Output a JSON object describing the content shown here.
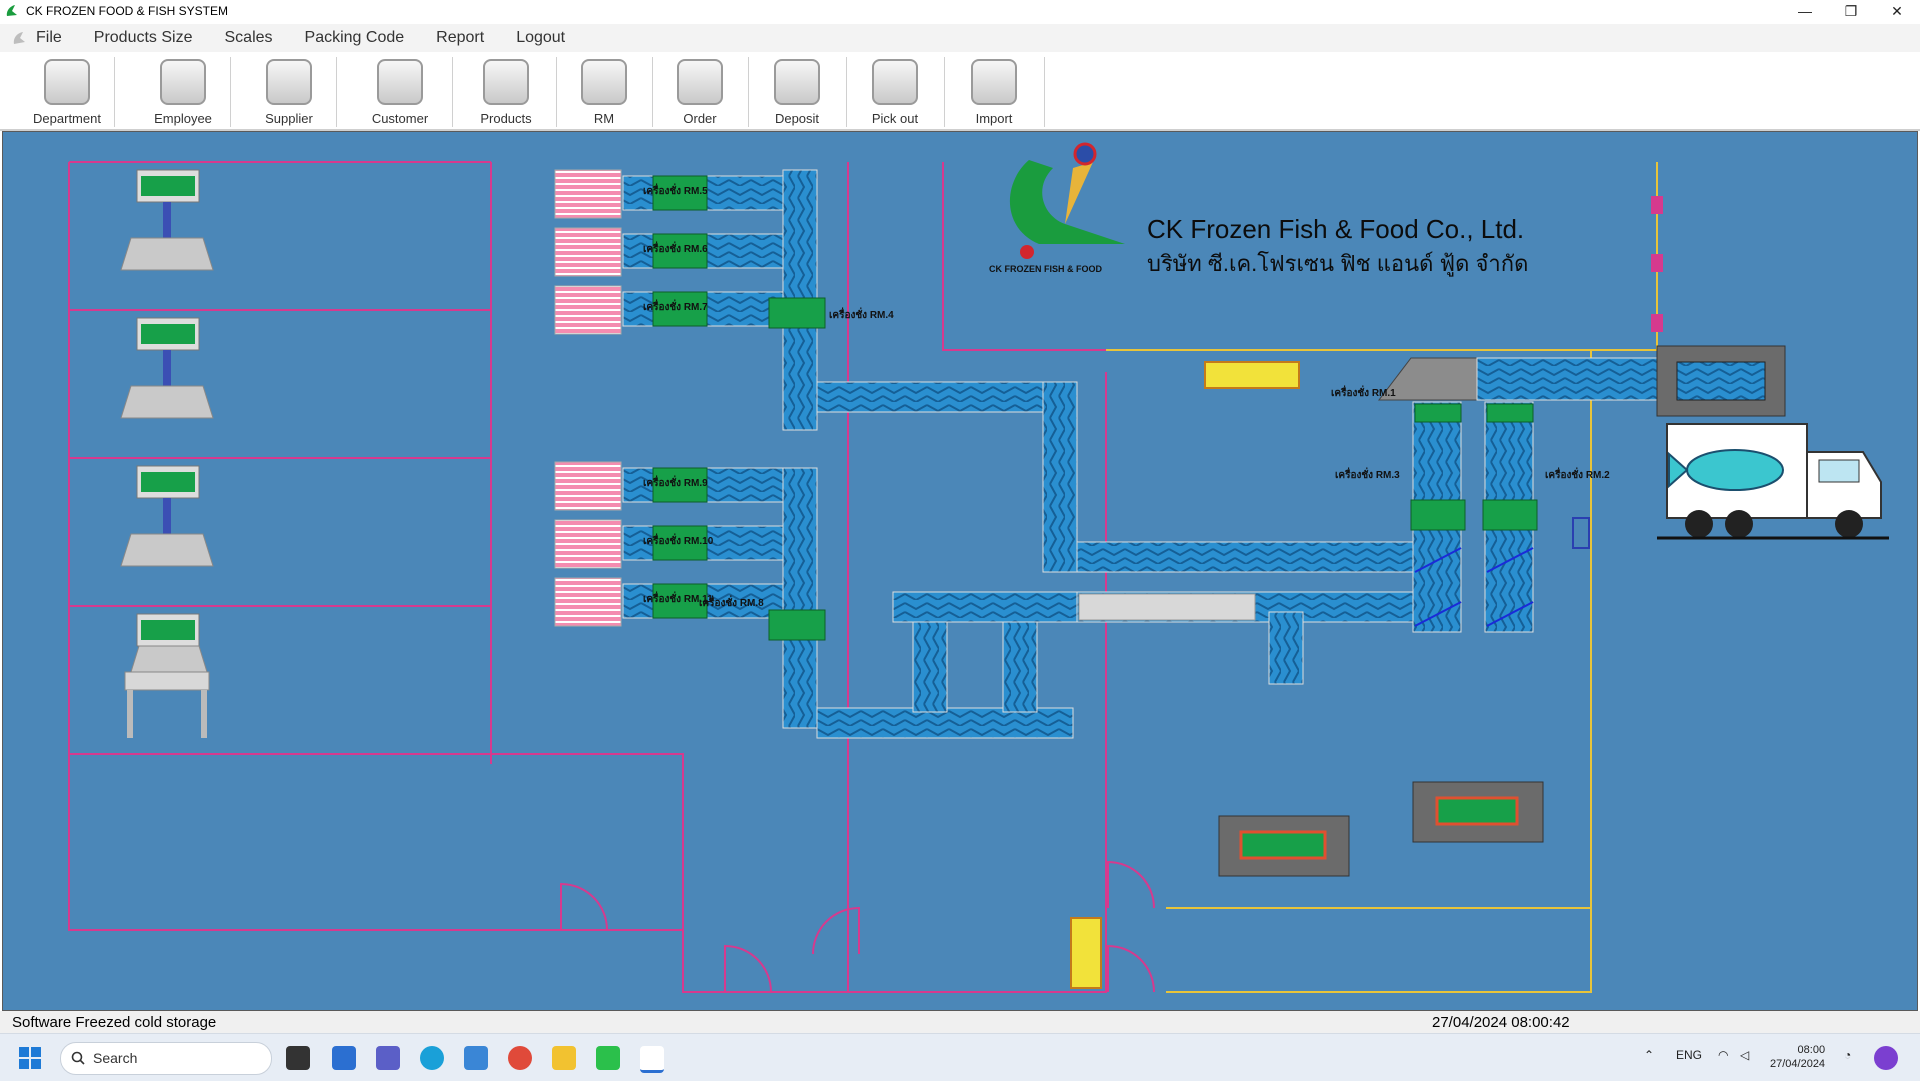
{
  "window": {
    "title": "CK FROZEN FOOD & FISH SYSTEM",
    "minimize": "—",
    "maximize": "❐",
    "close": "✕"
  },
  "menu": [
    "File",
    "Products Size",
    "Scales",
    "Packing Code",
    "Report",
    "Logout"
  ],
  "toolbar": [
    {
      "label": "Department",
      "icon": "department-icon"
    },
    {
      "label": "Employee",
      "icon": "employee-icon"
    },
    {
      "label": "Supplier",
      "icon": "supplier-icon"
    },
    {
      "label": "Customer",
      "icon": "customer-icon"
    },
    {
      "label": "Products",
      "icon": "fish-icon"
    },
    {
      "label": "RM",
      "icon": "calendar-icon"
    },
    {
      "label": "Order",
      "icon": "order-icon"
    },
    {
      "label": "Deposit",
      "icon": "deposit-icon"
    },
    {
      "label": "Pick out",
      "icon": "pickout-icon"
    },
    {
      "label": "Import",
      "icon": "import-icon"
    }
  ],
  "company": {
    "logo_text": "CK FROZEN FISH & FOOD",
    "name_en": "CK Frozen Fish & Food Co., Ltd.",
    "name_th": "บริษัท ซี.เค.โฟรเซน ฟิช แอนด์ ฟู้ด จำกัด"
  },
  "scales": [
    {
      "label": "เครื่องชั่ง RM.5"
    },
    {
      "label": "เครื่องชั่ง RM.6"
    },
    {
      "label": "เครื่องชั่ง RM.7"
    },
    {
      "label": "เครื่องชั่ง RM.4"
    },
    {
      "label": "เครื่องชั่ง RM.9"
    },
    {
      "label": "เครื่องชั่ง RM.10"
    },
    {
      "label": "เครื่องชั่ง RM.11"
    },
    {
      "label": "เครื่องชั่ง RM.8"
    },
    {
      "label": "เครื่องชั่ง RM.1"
    },
    {
      "label": "เครื่องชั่ง RM.3"
    },
    {
      "label": "เครื่องชั่ง RM.2"
    }
  ],
  "status": {
    "left": "Software Freezed cold storage",
    "right": "27/04/2024 08:00:42"
  },
  "taskbar": {
    "search": "Search",
    "lang": "ENG",
    "time": "08:00",
    "date": "27/04/2024"
  },
  "colors": {
    "canvas": "#4b87b8",
    "wall": "#d63a8e",
    "line_yellow": "#e8c43a",
    "conveyor": "#2a8fd0",
    "scale_green": "#17a049"
  }
}
